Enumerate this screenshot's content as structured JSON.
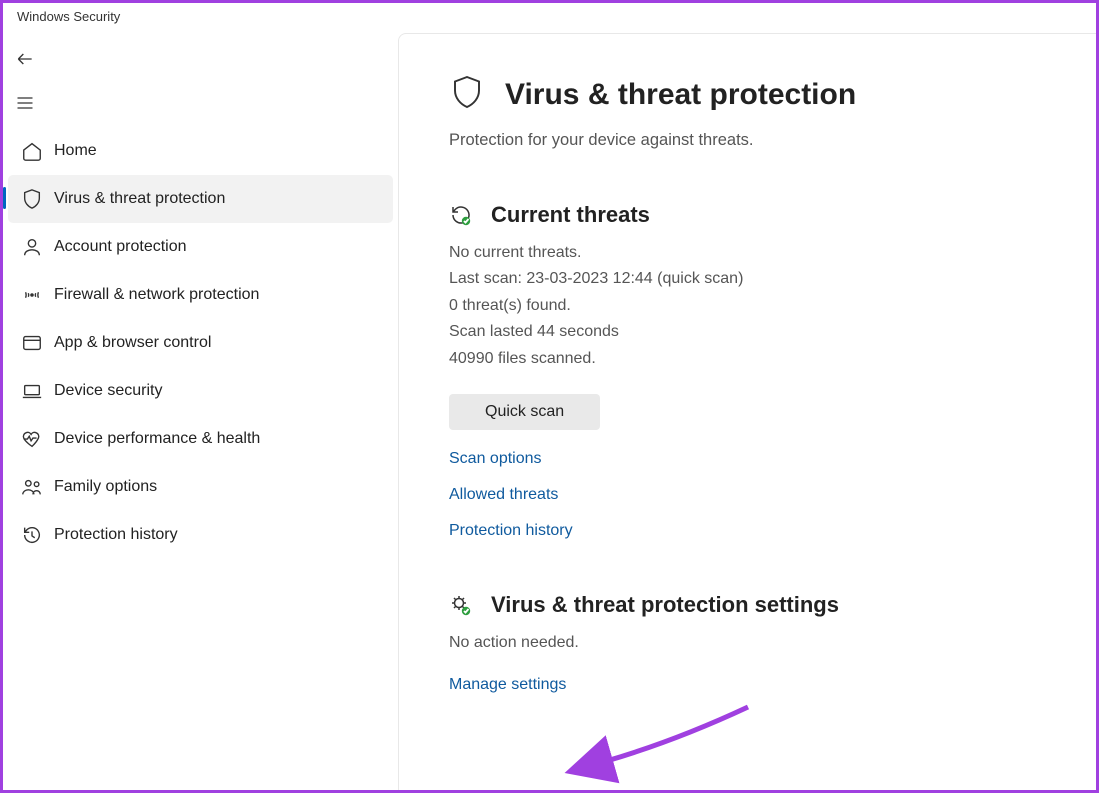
{
  "window": {
    "title": "Windows Security"
  },
  "sidebar": {
    "items": [
      {
        "label": "Home"
      },
      {
        "label": "Virus & threat protection"
      },
      {
        "label": "Account protection"
      },
      {
        "label": "Firewall & network protection"
      },
      {
        "label": "App & browser control"
      },
      {
        "label": "Device security"
      },
      {
        "label": "Device performance & health"
      },
      {
        "label": "Family options"
      },
      {
        "label": "Protection history"
      }
    ]
  },
  "page": {
    "title": "Virus & threat protection",
    "subtitle": "Protection for your device against threats."
  },
  "current_threats": {
    "heading": "Current threats",
    "no_threats": "No current threats.",
    "last_scan": "Last scan: 23-03-2023 12:44 (quick scan)",
    "threats_found": "0 threat(s) found.",
    "duration": "Scan lasted 44 seconds",
    "files_scanned": "40990 files scanned.",
    "quick_scan_label": "Quick scan",
    "links": {
      "scan_options": "Scan options",
      "allowed_threats": "Allowed threats",
      "protection_history": "Protection history"
    }
  },
  "settings_section": {
    "heading": "Virus & threat protection settings",
    "status": "No action needed.",
    "manage_link": "Manage settings"
  }
}
